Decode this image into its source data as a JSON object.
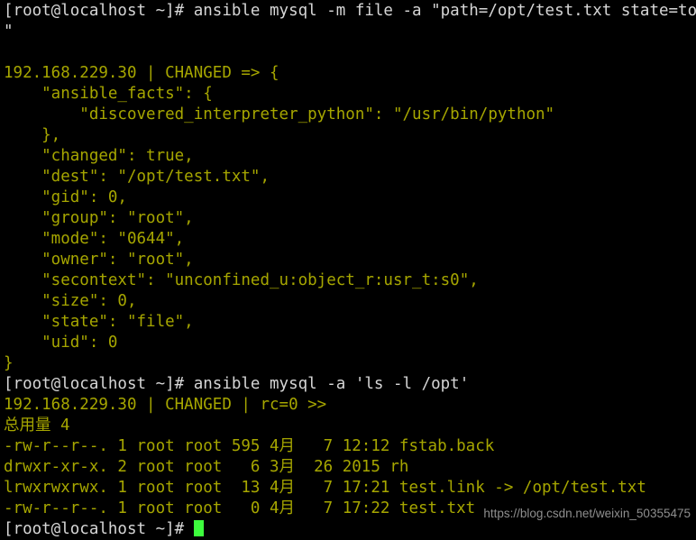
{
  "terminal": {
    "background_color": "#000000",
    "prompt_color": "#d6d6d6",
    "output_color": "#a6a600",
    "cursor_color": "#3dfc3d",
    "prompt_string": "[root@localhost ~]# ",
    "lines": [
      {
        "id": "cmd1",
        "type": "command",
        "text": "[root@localhost ~]# ansible mysql -m file -a \"path=/opt/test.txt state=touch"
      },
      {
        "id": "cmd1-wrap",
        "type": "command",
        "text": "\""
      },
      {
        "id": "blank1",
        "type": "blank",
        "text": ""
      },
      {
        "id": "host1",
        "type": "output",
        "text": "192.168.229.30 | CHANGED => {"
      },
      {
        "id": "facts-open",
        "type": "output",
        "text": "    \"ansible_facts\": {"
      },
      {
        "id": "interpreter",
        "type": "output",
        "text": "        \"discovered_interpreter_python\": \"/usr/bin/python\""
      },
      {
        "id": "facts-close",
        "type": "output",
        "text": "    },"
      },
      {
        "id": "changed",
        "type": "output",
        "text": "    \"changed\": true,"
      },
      {
        "id": "dest",
        "type": "output",
        "text": "    \"dest\": \"/opt/test.txt\","
      },
      {
        "id": "gid",
        "type": "output",
        "text": "    \"gid\": 0,"
      },
      {
        "id": "group",
        "type": "output",
        "text": "    \"group\": \"root\","
      },
      {
        "id": "mode",
        "type": "output",
        "text": "    \"mode\": \"0644\","
      },
      {
        "id": "owner",
        "type": "output",
        "text": "    \"owner\": \"root\","
      },
      {
        "id": "secontext",
        "type": "output",
        "text": "    \"secontext\": \"unconfined_u:object_r:usr_t:s0\","
      },
      {
        "id": "size",
        "type": "output",
        "text": "    \"size\": 0,"
      },
      {
        "id": "state",
        "type": "output",
        "text": "    \"state\": \"file\","
      },
      {
        "id": "uid",
        "type": "output",
        "text": "    \"uid\": 0"
      },
      {
        "id": "json-close",
        "type": "output",
        "text": "}"
      },
      {
        "id": "cmd2",
        "type": "command",
        "text": "[root@localhost ~]# ansible mysql -a 'ls -l /opt'"
      },
      {
        "id": "host2",
        "type": "output",
        "text": "192.168.229.30 | CHANGED | rc=0 >>"
      },
      {
        "id": "total",
        "type": "output",
        "text": "总用量 4"
      },
      {
        "id": "file-fstab",
        "type": "output",
        "text": "-rw-r--r--. 1 root root 595 4月   7 12:12 fstab.back"
      },
      {
        "id": "file-rh",
        "type": "output",
        "text": "drwxr-xr-x. 2 root root   6 3月  26 2015 rh"
      },
      {
        "id": "file-testlink",
        "type": "output",
        "text": "lrwxrwxrwx. 1 root root  13 4月   7 17:21 test.link -> /opt/test.txt"
      },
      {
        "id": "file-testtxt",
        "type": "output",
        "text": "-rw-r--r--. 1 root root   0 4月   7 17:22 test.txt"
      }
    ],
    "final_prompt": "[root@localhost ~]# "
  },
  "watermark": {
    "text": "https://blog.csdn.net/weixin_50355475"
  }
}
